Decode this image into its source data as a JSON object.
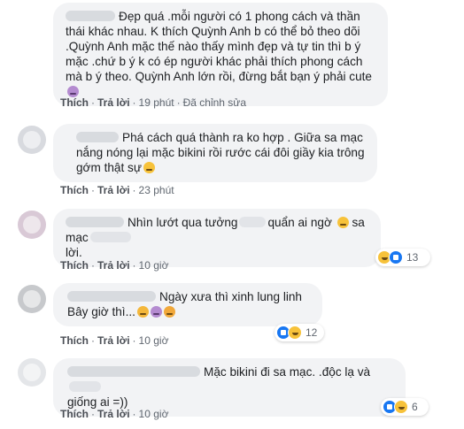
{
  "comments": [
    {
      "text": "Đẹp quá .mỗi người có 1 phong cách và thần thái khác nhau. K thích Quỳnh Anh b có thể bỏ theo dõi .Quỳnh Anh mặc thế nào thấy mình đẹp và tự tin thì b ý mặc .chứ b ý k có ép người khác phải thích phong cách mà b ý theo. Quỳnh Anh lớn rồi, đừng bắt bạn ý phải cute",
      "like": "Thích",
      "reply": "Trả lời",
      "time": "19 phút",
      "edited": "Đã chỉnh sửa"
    },
    {
      "text": "Phá cách quá thành ra ko hợp . Giữa sa mạc nắng nóng lại mặc bikini rồi rước cái đôi giầy kia trông gớm thật sự",
      "like": "Thích",
      "reply": "Trả lời",
      "time": "23 phút"
    },
    {
      "text_a": "Nhìn lướt qua tưởng",
      "text_b": "quẩn ai ngờ",
      "text_c": "sa mạc",
      "text_d": "lời.",
      "like": "Thích",
      "reply": "Trả lời",
      "time": "10 giờ",
      "reaction_count": "13"
    },
    {
      "line1": "Ngày xưa thì xinh lung linh",
      "line2": "Bây giờ thì...",
      "like": "Thích",
      "reply": "Trả lời",
      "time": "10 giờ",
      "reaction_count": "12"
    },
    {
      "text_a": "Mặc bikini đi sa mạc. .độc lạ và",
      "text_b": "giống ai =))",
      "like": "Thích",
      "reply": "Trả lời",
      "time": "10 giờ",
      "reaction_count": "6"
    }
  ],
  "icons": {
    "like_reaction": "like-icon",
    "haha_reaction": "haha-icon"
  },
  "colors": {
    "bubble": "#f2f3f5",
    "like_blue": "#1877f2",
    "haha_yellow": "#f7c23a",
    "meta_text": "#606770"
  }
}
